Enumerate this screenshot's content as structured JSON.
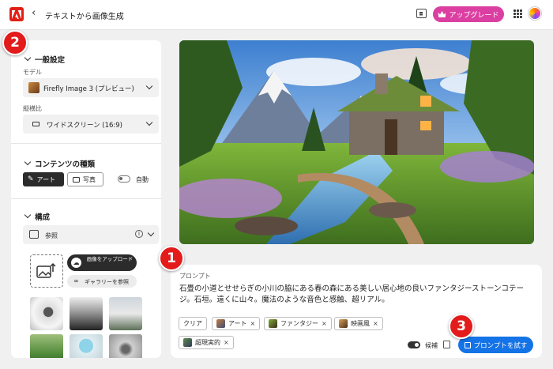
{
  "header": {
    "title": "テキストから画像生成",
    "upgrade_label": "アップグレード"
  },
  "left_panel": {
    "general": {
      "heading": "一般設定",
      "model_label": "モデル",
      "model_value": "Firefly Image 3 (プレビュー)",
      "aspect_label": "縦横比",
      "aspect_value": "ワイドスクリーン (16:9)"
    },
    "content_type": {
      "heading": "コンテンツの種類",
      "art_label": "アート",
      "photo_label": "写真",
      "auto_label": "自動"
    },
    "composition": {
      "heading": "構成",
      "reference_label": "参照",
      "upload_label": "画像をアップロード",
      "gallery_label": "ギャラリーを参照"
    }
  },
  "prompt": {
    "label": "プロンプト",
    "text": "石畳の小道とせせらぎの小川の脇にある春の森にある美しい居心地の良いファンタジーストーンコテージ。石垣。遠くに山々。魔法のような音色と感触、超リアル。",
    "tags": [
      {
        "label": "クリア"
      },
      {
        "label": "アート"
      },
      {
        "label": "ファンタジー"
      },
      {
        "label": "映画風"
      },
      {
        "label": "超現実的"
      }
    ],
    "assist_label": "候補",
    "generate_label": "プロンプトを試す"
  },
  "annotations": {
    "badge1": "1",
    "badge2": "2",
    "badge3": "3"
  },
  "colors": {
    "accent": "#1473e6",
    "upgrade": "#db3fa1",
    "badge": "#e31b1b",
    "adobe": "#e21f17"
  }
}
